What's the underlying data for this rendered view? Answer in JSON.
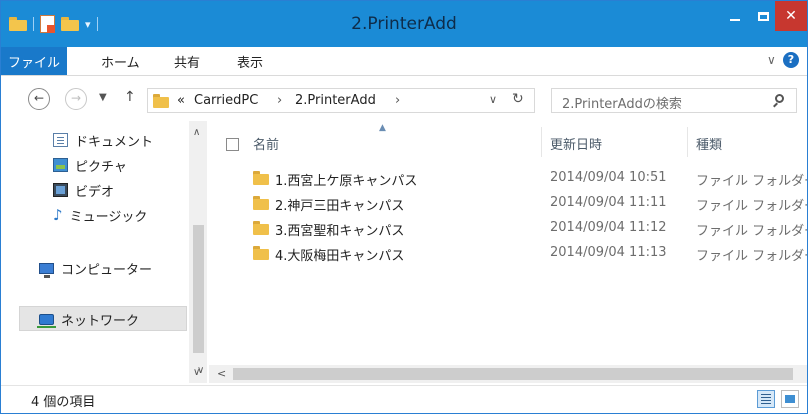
{
  "window": {
    "title": "2.PrinterAdd"
  },
  "ribbon": {
    "tabs": [
      {
        "label": "ファイル"
      },
      {
        "label": "ホーム"
      },
      {
        "label": "共有"
      },
      {
        "label": "表示"
      }
    ]
  },
  "address": {
    "overflow": "«",
    "crumbs": [
      "CarriedPC",
      "2.PrinterAdd"
    ],
    "separator": "›"
  },
  "search": {
    "placeholder": "2.PrinterAddの検索"
  },
  "navpane": {
    "items": [
      {
        "label": "ドキュメント",
        "icon": "documents-icon"
      },
      {
        "label": "ピクチャ",
        "icon": "pictures-icon"
      },
      {
        "label": "ビデオ",
        "icon": "videos-icon"
      },
      {
        "label": "ミュージック",
        "icon": "music-icon"
      },
      {
        "label": "コンピューター",
        "icon": "computer-icon"
      },
      {
        "label": "ネットワーク",
        "icon": "network-icon"
      }
    ],
    "selected": "ネットワーク"
  },
  "columns": {
    "name": "名前",
    "date": "更新日時",
    "type": "種類"
  },
  "files": [
    {
      "name": "1.西宮上ケ原キャンパス",
      "date": "2014/09/04 10:51",
      "type": "ファイル フォルダー"
    },
    {
      "name": "2.神戸三田キャンパス",
      "date": "2014/09/04 11:11",
      "type": "ファイル フォルダー"
    },
    {
      "name": "3.西宮聖和キャンパス",
      "date": "2014/09/04 11:12",
      "type": "ファイル フォルダー"
    },
    {
      "name": "4.大阪梅田キャンパス",
      "date": "2014/09/04 11:13",
      "type": "ファイル フォルダー"
    }
  ],
  "status": {
    "item_count": "4 個の項目"
  },
  "colors": {
    "titlebar": "#1b8bd6",
    "file_tab": "#1979ca",
    "close": "#c7372f",
    "folder": "#f0c04a"
  }
}
